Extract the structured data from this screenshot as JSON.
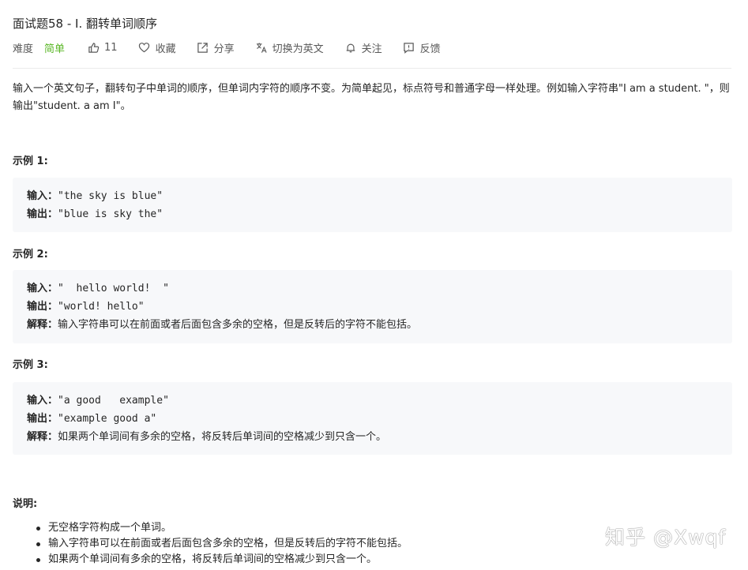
{
  "problem": {
    "title": "面试题58 - I. 翻转单词顺序",
    "difficulty_label": "难度",
    "difficulty": "简单",
    "likes": "11",
    "favorite": "收藏",
    "share": "分享",
    "switch_lang": "切换为英文",
    "follow": "关注",
    "feedback": "反馈",
    "description": "输入一个英文句子，翻转句子中单词的顺序，但单词内字符的顺序不变。为简单起见，标点符号和普通字母一样处理。例如输入字符串\"I am a student. \"，则输出\"student. a am I\"。"
  },
  "examples": [
    {
      "heading": "示例 1:",
      "input_label": "输入：",
      "input": "\"the sky is blue\"",
      "output_label": "输出：",
      "output": "\"blue is sky the\""
    },
    {
      "heading": "示例 2:",
      "input_label": "输入：",
      "input": "\"  hello world!  \"",
      "output_label": "输出：",
      "output": "\"world! hello\"",
      "explain_label": "解释：",
      "explain": "输入字符串可以在前面或者后面包含多余的空格，但是反转后的字符不能包括。"
    },
    {
      "heading": "示例 3:",
      "input_label": "输入：",
      "input": "\"a good   example\"",
      "output_label": "输出：",
      "output": "\"example good a\"",
      "explain_label": "解释：",
      "explain": "如果两个单词间有多余的空格，将反转后单词间的空格减少到只含一个。"
    }
  ],
  "notes": {
    "heading": "说明:",
    "items": [
      "无空格字符构成一个单词。",
      "输入字符串可以在前面或者后面包含多余的空格，但是反转后的字符不能包括。",
      "如果两个单词间有多余的空格，将反转后单词间的空格减少到只含一个。"
    ]
  },
  "watermark": "知乎 @Xwqf",
  "colors": {
    "easy": "#5ab726",
    "code_bg": "#f7f8fa",
    "meta_text": "#595959"
  }
}
